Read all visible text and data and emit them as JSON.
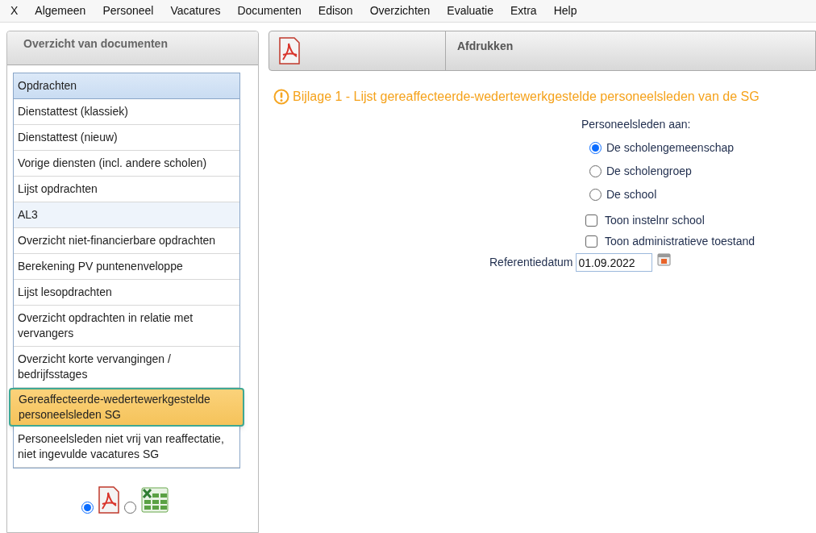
{
  "menu": [
    "X",
    "Algemeen",
    "Personeel",
    "Vacatures",
    "Documenten",
    "Edison",
    "Overzichten",
    "Evaluatie",
    "Extra",
    "Help"
  ],
  "sidebar": {
    "title": "Overzicht van documenten",
    "items": [
      {
        "kind": "header",
        "label": "Opdrachten",
        "selected": false
      },
      {
        "kind": "item",
        "label": "Dienstattest (klassiek)",
        "selected": false
      },
      {
        "kind": "item",
        "label": "Dienstattest (nieuw)",
        "selected": false
      },
      {
        "kind": "item",
        "label": "Vorige diensten (incl. andere scholen)",
        "selected": false
      },
      {
        "kind": "item",
        "label": "Lijst opdrachten",
        "selected": false
      },
      {
        "kind": "header",
        "label": "AL3",
        "selected": false
      },
      {
        "kind": "item",
        "label": "Overzicht niet-financierbare opdrachten",
        "selected": false
      },
      {
        "kind": "item",
        "label": "Berekening PV puntenenveloppe",
        "selected": false
      },
      {
        "kind": "item",
        "label": "Lijst lesopdrachten",
        "selected": false
      },
      {
        "kind": "item",
        "label": "Overzicht opdrachten in relatie met vervangers",
        "selected": false
      },
      {
        "kind": "item",
        "label": "Overzicht korte vervangingen / bedrijfsstages",
        "selected": false
      },
      {
        "kind": "item",
        "label": "Gereaffecteerde-wedertewerkgestelde personeelsleden SG",
        "selected": true
      },
      {
        "kind": "item",
        "label": "Personeelsleden niet vrij van reaffectatie, niet ingevulde vacatures SG",
        "selected": false
      }
    ],
    "formats": [
      {
        "kind": "pdf",
        "selected": true
      },
      {
        "kind": "excel",
        "selected": false
      }
    ]
  },
  "toolbar": {
    "title": "Afdrukken"
  },
  "report": {
    "title": "Bijlage 1 - Lijst gereaffecteerde-wedertewerkgestelde personeelsleden van de SG",
    "group_label": "Personeelsleden aan:",
    "options": [
      {
        "label": "De scholengemeenschap",
        "selected": true
      },
      {
        "label": "De scholengroep",
        "selected": false
      },
      {
        "label": "De school",
        "selected": false
      }
    ],
    "checkboxes": [
      {
        "label": "Toon instelnr school",
        "checked": false
      },
      {
        "label": "Toon administratieve toestand",
        "checked": false
      }
    ],
    "date": {
      "label": "Referentiedatum",
      "value": "01.09.2022"
    }
  }
}
